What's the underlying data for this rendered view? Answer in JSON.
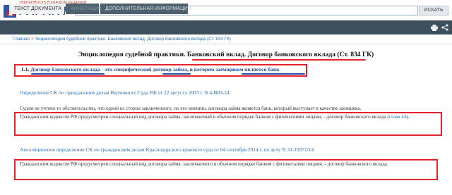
{
  "logo": {
    "tagline": "УВЕРЕННОСТЬ В КАЖДОМ РЕШЕНИИ",
    "name": "ГАРАНТ"
  },
  "search": {
    "value": "",
    "button_label": "ИСКАТЬ"
  },
  "tabs": [
    {
      "label": "ТЕКСТ ДОКУМЕНТА"
    },
    {
      "label": "АННОТАЦИЯ"
    },
    {
      "label": "ДОПОЛНИТЕЛЬНАЯ ИНФОРМАЦИЯ"
    }
  ],
  "breadcrumb": {
    "home": "Главная",
    "separator": ">",
    "current": "Энциклопедия судебной практики. Банковский вклад. Договор банковского вклада (Ст. 834 ГК)"
  },
  "document": {
    "title": "Энциклопедия судебной практики. Банковский вклад. Договор банковского вклада (Ст. 834 ГК)",
    "section": {
      "number": "1.1.",
      "text": "Договор банковского вклада - это специфический договор займа, в котором заемщиком является банк"
    },
    "ruling1": {
      "link": "Определение СК по гражданским делам Верховного Суда РФ от 22 августа 2003 г. N 4-В03-24",
      "para1": "Судом не учтено то обстоятельство, что одной из сторон заключенного, по его мнению, договора займа является банк, который выступает в качестве заемщика.",
      "para2_text": "Гражданским кодексом РФ предусмотрен специальный вид договора займа, заключаемый в обычном порядке банком с физическими лицами, - договор банковского вклада (",
      "para2_link": "глава 44",
      "para2_end": ")."
    },
    "ruling2": {
      "link": "Апелляционное определение СК по гражданским делам Краснодарского краевого суда от 04 сентября 2014 г. по делу N 33-19371/14",
      "para": "Гражданским кодексом РФ предусмотрен специальный вид договора займа, заключаемого в обычном порядке банком с физическими лицами, - договор банковского вклада."
    }
  },
  "colors": {
    "accent_red": "#e2242a",
    "link_blue": "#2a6fb0",
    "tabbar": "#3d4e5c"
  },
  "icons": [
    "logo-mark-icon",
    "print-icon",
    "share-icon"
  ]
}
